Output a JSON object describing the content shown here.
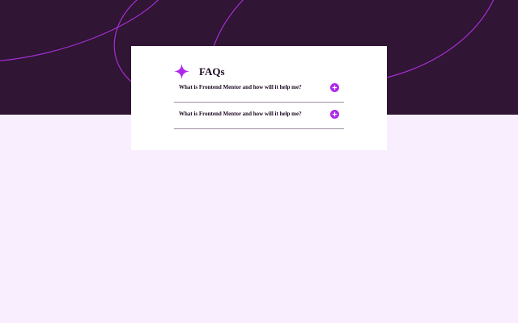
{
  "faq": {
    "title": "FAQs",
    "icons": {
      "header": "star-icon",
      "toggle": "plus-icon"
    },
    "items": [
      {
        "question": "What is Frontend Mentor and how will it help me?",
        "expanded": false
      },
      {
        "question": "What is Frontend Mentor and how will it help me?",
        "expanded": false
      }
    ]
  },
  "colors": {
    "hero_background": "#301534",
    "page_background": "#f8eefe",
    "accent": "#ad28eb",
    "card_background": "#ffffff",
    "divider": "#9e8ea2",
    "text": "#1b0720"
  }
}
